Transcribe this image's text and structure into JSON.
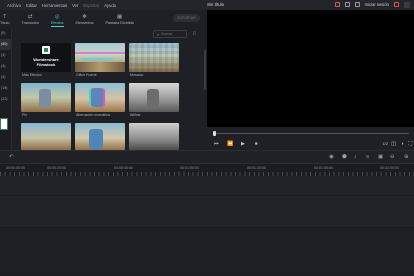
{
  "menu": {
    "app_glyph": "File",
    "items": [
      "Archivo",
      "Editar",
      "Herramientas",
      "Ver",
      "Exportar",
      "Ayuda"
    ],
    "dim_items": [
      "Exportar"
    ]
  },
  "window": {
    "title": "Sin título",
    "login": "Iniciar sesión"
  },
  "library_tabs": [
    {
      "label": "Título",
      "icon": "T",
      "active": false
    },
    {
      "label": "Transición",
      "icon": "⇄",
      "active": false
    },
    {
      "label": "Efectos",
      "icon": "◎",
      "active": true
    },
    {
      "label": "Elementos",
      "icon": "✥",
      "active": false
    },
    {
      "label": "Pantalla Dividida",
      "icon": "▦",
      "active": false
    }
  ],
  "export_button": "EXPORTAR",
  "side_list": [
    "(0)",
    "(80)",
    "(3)",
    "(4)",
    "(4)",
    "(19)",
    "(22)"
  ],
  "search": {
    "placeholder": "Buscar"
  },
  "effects": [
    {
      "label": "Más Efectos",
      "kind": "wondershare",
      "logo_line1": "Wondershare",
      "logo_line2": "Filmstock"
    },
    {
      "label": "Glitch Fuerte",
      "kind": "glitch"
    },
    {
      "label": "Mosaico",
      "kind": "mosaic"
    },
    {
      "label": "Pix",
      "kind": "pix"
    },
    {
      "label": "Aberración cromática",
      "kind": "chromatic"
    },
    {
      "label": "Willow",
      "kind": "willow"
    },
    {
      "label": "",
      "kind": "plain1"
    },
    {
      "label": "",
      "kind": "plain2"
    },
    {
      "label": "",
      "kind": "plain3"
    }
  ],
  "preview": {
    "ratio": "1/2",
    "controls": [
      "⏮",
      "⏪",
      "▶",
      "⏹"
    ]
  },
  "timeline": {
    "ruler_labels": [
      "00:00:00:00",
      "00:00:20:00",
      "00:00:40:00",
      "00:01:00:00",
      "00:01:20:00",
      "00:01:40:00",
      "00:02:00:00"
    ]
  },
  "colors": {
    "accent": "#4fd3c4"
  }
}
